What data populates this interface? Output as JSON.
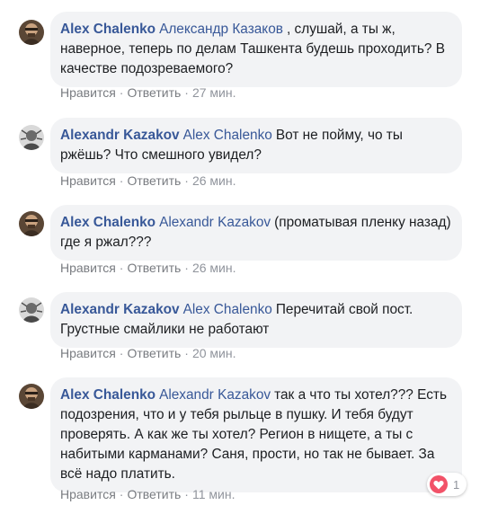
{
  "comments": [
    {
      "author": "Alex Chalenko",
      "mention": "Александр Казаков",
      "text": ", слушай, а ты ж, наверное, теперь по делам Ташкента будешь проходить? В качестве подозреваемого?",
      "like": "Нравится",
      "reply": "Ответить",
      "time": "27 мин.",
      "avatar": "avatar-alex-chalenko"
    },
    {
      "author": "Alexandr Kazakov",
      "mention": "Alex Chalenko",
      "text": "Вот не пойму, чо ты ржёшь? Что смешного увидел?",
      "like": "Нравится",
      "reply": "Ответить",
      "time": "26 мин.",
      "avatar": "avatar-alexandr-kazakov"
    },
    {
      "author": "Alex Chalenko",
      "mention": "Alexandr Kazakov",
      "text": "(проматывая пленку назад) где я ржал???",
      "like": "Нравится",
      "reply": "Ответить",
      "time": "26 мин.",
      "avatar": "avatar-alex-chalenko"
    },
    {
      "author": "Alexandr Kazakov",
      "mention": "Alex Chalenko",
      "text": "Перечитай свой пост. Грустные смайлики не работают",
      "like": "Нравится",
      "reply": "Ответить",
      "time": "20 мин.",
      "avatar": "avatar-alexandr-kazakov"
    },
    {
      "author": "Alex Chalenko",
      "mention": "Alexandr Kazakov",
      "text": "так а что ты хотел??? Есть подозрения, что и у тебя рыльце в пушку. И тебя будут проверять. А как же ты хотел? Регион в нищете, а ты с набитыми карманами? Саня, прости, но так не бывает. За всё надо платить.",
      "like": "Нравится",
      "reply": "Ответить",
      "time": "11 мин.",
      "avatar": "avatar-alex-chalenko",
      "reaction": {
        "icon": "heart-icon",
        "count": "1",
        "color": "#f25268"
      }
    }
  ],
  "colors": {
    "name": "#385898",
    "bubble": "#f2f3f5",
    "meta": "#90949c",
    "text": "#1c1e21"
  }
}
